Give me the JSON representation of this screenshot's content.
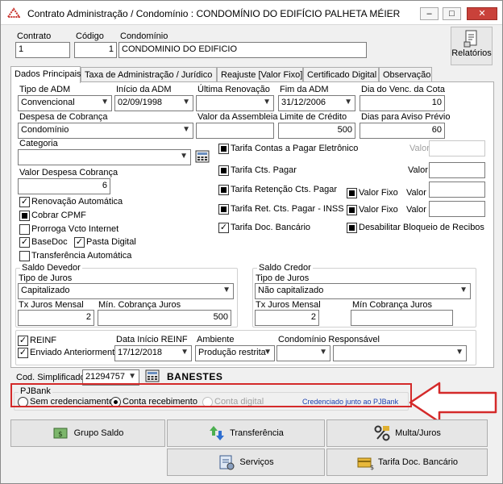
{
  "window": {
    "title": "Contrato Administração / Condomínio : CONDOMÍNIO DO EDIFÍCIO PALHETA MÉIER",
    "min_glyph": "–",
    "max_glyph": "□",
    "close_glyph": "✕"
  },
  "header": {
    "contrato_label": "Contrato",
    "contrato_value": "1",
    "codigo_label": "Código",
    "codigo_value": "1",
    "condominio_label": "Condomínio",
    "condominio_value": "CONDOMINIO DO EDIFICIO",
    "relatorios_label": "Relatórios"
  },
  "tabs": [
    {
      "label": "Dados Principais"
    },
    {
      "label": "Taxa de Administração / Jurídico"
    },
    {
      "label": "Reajuste [Valor Fixo]"
    },
    {
      "label": "Certificado Digital"
    },
    {
      "label": "Observação"
    }
  ],
  "form": {
    "tipo_adm_label": "Tipo de ADM",
    "tipo_adm_value": "Convencional",
    "inicio_adm_label": "Início da ADM",
    "inicio_adm_value": "02/09/1998",
    "ultima_renovacao_label": "Última Renovação",
    "ultima_renovacao_value": "",
    "fim_adm_label": "Fim da ADM",
    "fim_adm_value": "31/12/2006",
    "dia_venc_label": "Dia do Venc. da Cota",
    "dia_venc_value": "10",
    "despesa_cobranca_label": "Despesa de Cobrança",
    "despesa_cobranca_value": "Condomínio",
    "valor_assembleia_label": "Valor da Assembleia",
    "valor_assembleia_value": "",
    "limite_credito_label": "Limite de Crédito",
    "limite_credito_value": "500",
    "dias_aviso_label": "Dias para Aviso Prévio",
    "dias_aviso_value": "60",
    "categoria_label": "Categoria",
    "categoria_value": "",
    "valor_despesa_label": "Valor Despesa Cobrança",
    "valor_despesa_value": "6"
  },
  "checks": {
    "renovacao": "Renovação Automática",
    "cobrar_cpmf": "Cobrar CPMF",
    "prorroga": "Prorroga Vcto Internet",
    "basedoc": "BaseDoc",
    "pasta_digital": "Pasta Digital",
    "transferencia": "Transferência Automática"
  },
  "tarifas": {
    "contas_pagar_eletronico": "Tarifa Contas a Pagar Eletrônico",
    "cts_pagar": "Tarifa Cts. Pagar",
    "retencao": "Tarifa Retenção Cts. Pagar",
    "ret_inss": "Tarifa Ret. Cts. Pagar - INSS",
    "doc_bancario": "Tarifa Doc. Bancário",
    "valor_fixo": "Valor Fixo",
    "valor": "Valor",
    "desabilitar": "Desabilitar Bloqueio de Recibos"
  },
  "saldo_devedor": {
    "title": "Saldo Devedor",
    "tipo_juros_label": "Tipo de Juros",
    "tipo_juros_value": "Capitalizado",
    "tx_juros_label": "Tx Juros Mensal",
    "tx_juros_value": "2",
    "min_cobranca_label": "Mín. Cobrança Juros",
    "min_cobranca_value": "500"
  },
  "saldo_credor": {
    "title": "Saldo Credor",
    "tipo_juros_label": "Tipo de Juros",
    "tipo_juros_value": "Não capitalizado",
    "tx_juros_label": "Tx Juros Mensal",
    "tx_juros_value": "2",
    "min_cobranca_label": "Mín Cobrança Juros",
    "min_cobranca_value": ""
  },
  "reinf": {
    "reinf_label": "REINF",
    "enviado_label": "Enviado Anteriormente",
    "data_inicio_label": "Data Início REINF",
    "data_inicio_value": "17/12/2018",
    "ambiente_label": "Ambiente",
    "ambiente_value": "Produção restrita",
    "condominio_resp_label": "Condomínio Responsável",
    "condominio_resp_value": ""
  },
  "cod_simplificado": {
    "label": "Cod. Simplificado",
    "value": "21294757",
    "bank": "BANESTES"
  },
  "pjbank": {
    "title": "PJBank",
    "sem": "Sem credenciamento",
    "conta_recebimento": "Conta recebimento",
    "conta_digital": "Conta digital",
    "credenciado": "Credenciado junto ao PJBank"
  },
  "buttons": {
    "grupo_saldo": "Grupo Saldo",
    "transferencia": "Transferência",
    "multa_juros": "Multa/Juros",
    "servicos": "Serviços",
    "tarifa_doc": "Tarifa Doc. Bancário"
  },
  "colors": {
    "annotation_red": "#d42a2a",
    "link_blue": "#1a3fb0"
  }
}
